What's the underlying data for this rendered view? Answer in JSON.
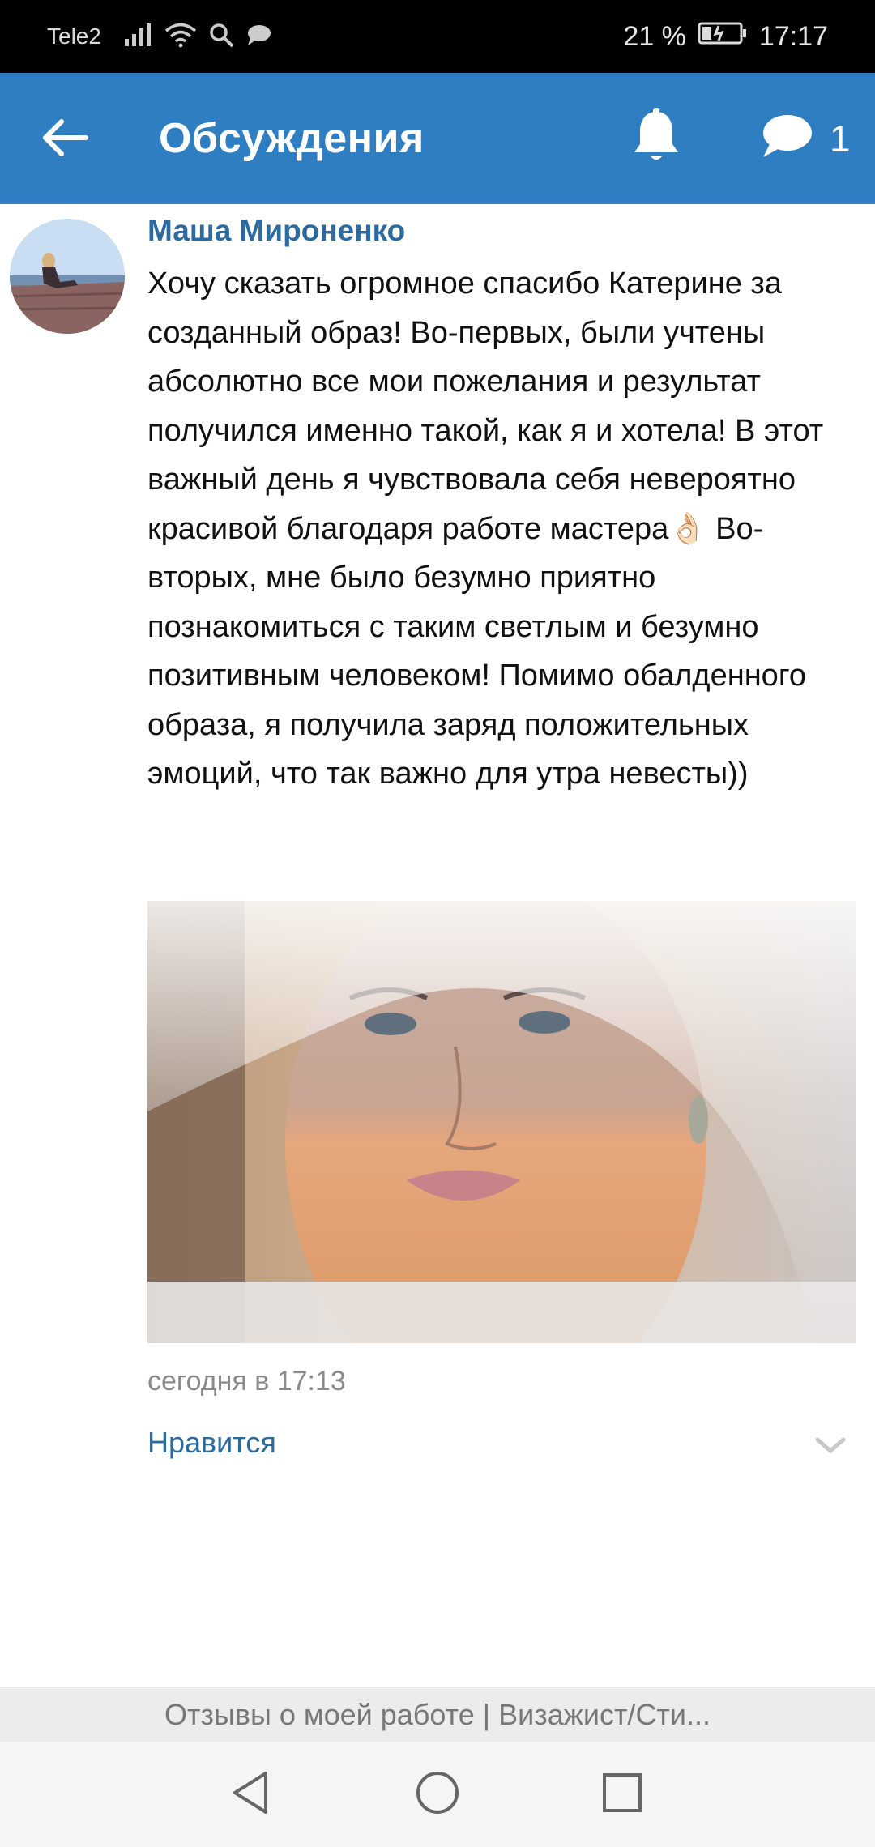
{
  "status_bar": {
    "carrier": "Tele2",
    "battery": "21 %",
    "time": "17:17"
  },
  "header": {
    "title": "Обсуждения",
    "message_count": "1"
  },
  "post": {
    "author": "Маша Мироненко",
    "text": "Хочу сказать огромное спасибо Катерине за созданный образ! Во-первых, были учтены абсолютно все мои пожелания и результат получился именно такой, как я и хотела! В этот важный день я чувствовала себя невероятно красивой благодаря работе мастера👌🏻 Во-вторых, мне было безумно приятно познакомиться с таким светлым и безумно позитивным человеком! Помимо обалденного образа, я получила заряд положительных эмоций, что так важно для утра невесты))",
    "timestamp": "сегодня в 17:13",
    "like_label": "Нравится"
  },
  "footer": {
    "group_title": "Отзывы о моей работе | Визажист/Сти..."
  },
  "colors": {
    "header_bg": "#2f7ec1",
    "link": "#2c6aa0"
  }
}
